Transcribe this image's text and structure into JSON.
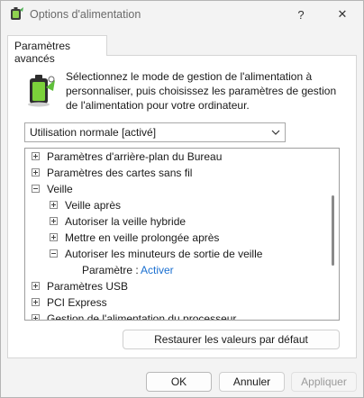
{
  "window": {
    "title": "Options d'alimentation",
    "help_label": "?",
    "close_label": "✕"
  },
  "tabs": [
    {
      "label": "Paramètres avancés"
    }
  ],
  "instruction": "Sélectionnez le mode de gestion de l'alimentation à personnaliser, puis choisissez les paramètres de gestion de l'alimentation pour votre ordinateur.",
  "plan_select": {
    "value": "Utilisation normale [activé]"
  },
  "tree": {
    "items": [
      {
        "label": "Paramètres d'arrière-plan du Bureau",
        "state": "collapsed"
      },
      {
        "label": "Paramètres des cartes sans fil",
        "state": "collapsed"
      },
      {
        "label": "Veille",
        "state": "expanded"
      },
      {
        "label": "Veille après",
        "state": "collapsed"
      },
      {
        "label": "Autoriser la veille hybride",
        "state": "collapsed"
      },
      {
        "label": "Mettre en veille prolongée après",
        "state": "collapsed"
      },
      {
        "label": "Autoriser les minuteurs de sortie de veille",
        "state": "expanded"
      },
      {
        "label": "Paramètre :",
        "value": "Activer"
      },
      {
        "label": "Paramètres USB",
        "state": "collapsed"
      },
      {
        "label": "PCI Express",
        "state": "collapsed"
      },
      {
        "label": "Gestion de l'alimentation du processeur",
        "state": "collapsed"
      }
    ]
  },
  "buttons": {
    "restore": "Restaurer les valeurs par défaut",
    "ok": "OK",
    "cancel": "Annuler",
    "apply": "Appliquer"
  },
  "icons": {
    "title": "power-options-icon",
    "battery": "battery-icon",
    "dropdown": "chevron-down-icon"
  },
  "colors": {
    "link": "#1a6fd0",
    "disabled_text": "#9a9a9a"
  }
}
